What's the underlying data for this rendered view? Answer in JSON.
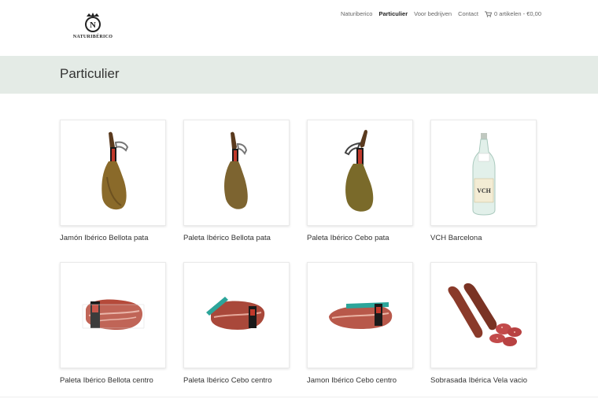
{
  "header": {
    "logo_text": "NATURIBÉRICO",
    "nav": [
      {
        "label": "Naturiberico",
        "active": false
      },
      {
        "label": "Particulier",
        "active": true
      },
      {
        "label": "Voor bedrijven",
        "active": false
      },
      {
        "label": "Contact",
        "active": false
      }
    ],
    "cart_label": "0 artikelen - €0,00"
  },
  "page": {
    "title": "Particulier"
  },
  "products": [
    {
      "name": "Jamón Ibérico Bellota pata",
      "image": "ham-leg-icon"
    },
    {
      "name": "Paleta Ibérico Bellota pata",
      "image": "ham-leg-icon"
    },
    {
      "name": "Paleta Ibérico Cebo pata",
      "image": "ham-leg-icon"
    },
    {
      "name": "VCH Barcelona",
      "image": "water-bottle-icon"
    },
    {
      "name": "Paleta Ibérico Bellota centro",
      "image": "ham-center-icon"
    },
    {
      "name": "Paleta Ibérico Cebo centro",
      "image": "ham-center-icon"
    },
    {
      "name": "Jamon Ibérico Cebo centro",
      "image": "ham-center-icon"
    },
    {
      "name": "Sobrasada Ibérica Vela vacio",
      "image": "sausage-icon"
    }
  ],
  "colors": {
    "titlebar_bg": "#e4ebe6",
    "text": "#333333",
    "nav_active": "#222222"
  }
}
